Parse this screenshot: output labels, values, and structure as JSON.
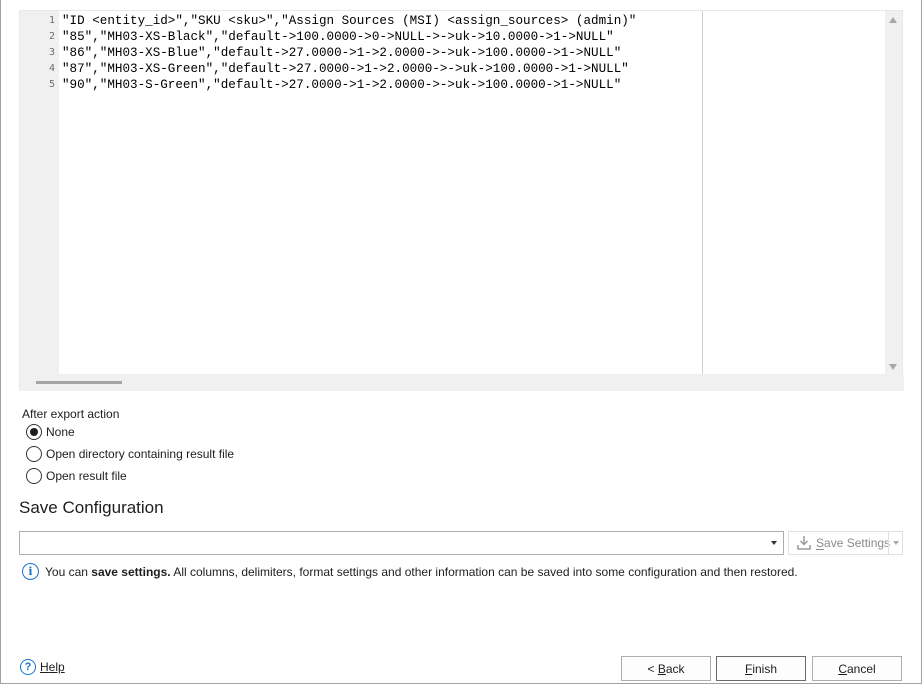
{
  "editor": {
    "line_numbers": [
      "1",
      "2",
      "3",
      "4",
      "5"
    ],
    "lines": [
      "\"ID <entity_id>\",\"SKU <sku>\",\"Assign Sources (MSI) <assign_sources> (admin)\"",
      "\"85\",\"MH03-XS-Black\",\"default->100.0000->0->NULL->->uk->10.0000->1->NULL\"",
      "\"86\",\"MH03-XS-Blue\",\"default->27.0000->1->2.0000->->uk->100.0000->1->NULL\"",
      "\"87\",\"MH03-XS-Green\",\"default->27.0000->1->2.0000->->uk->100.0000->1->NULL\"",
      "\"90\",\"MH03-S-Green\",\"default->27.0000->1->2.0000->->uk->100.0000->1->NULL\""
    ]
  },
  "after_export": {
    "label": "After export action",
    "options": [
      {
        "label": "None",
        "checked": true
      },
      {
        "label": "Open directory containing result file",
        "checked": false
      },
      {
        "label": "Open result file",
        "checked": false
      }
    ]
  },
  "save_config": {
    "title": "Save Configuration",
    "combo_value": "",
    "save_button_first": "S",
    "save_button_rest": "ave Settings"
  },
  "info": {
    "prefix": "You can ",
    "bold": "save settings.",
    "suffix": " All columns, delimiters, format settings and other information can be saved into some configuration and then restored."
  },
  "footer": {
    "help_first": "H",
    "help_rest": "elp",
    "back_prefix": "< ",
    "back_first": "B",
    "back_rest": "ack",
    "finish_first": "F",
    "finish_rest": "inish",
    "cancel_first": "C",
    "cancel_rest": "ancel"
  },
  "colors": {
    "accent": "#1a73c9",
    "gutter_bg": "#f0f0f0",
    "disabled_text": "#8a8a8a"
  },
  "icons": {
    "info": "info-icon",
    "help": "help-icon",
    "save": "download-tray-icon"
  }
}
